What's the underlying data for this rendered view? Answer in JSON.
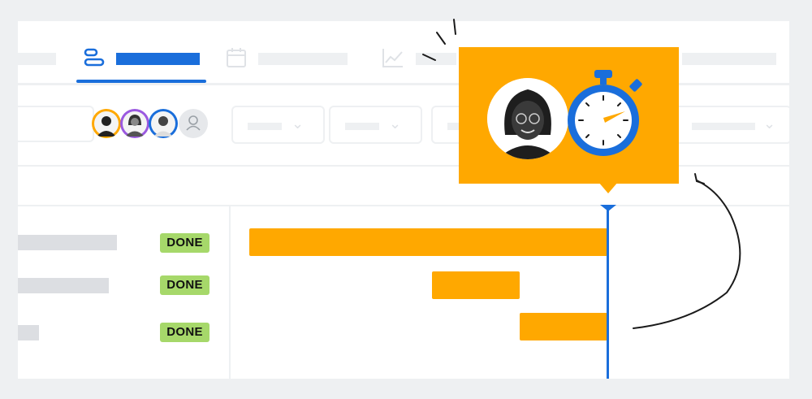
{
  "tabs": {
    "items": [
      {
        "icon": "timeline-icon",
        "active": true
      },
      {
        "icon": "calendar-icon",
        "active": false
      },
      {
        "icon": "chart-icon",
        "active": false
      }
    ]
  },
  "colors": {
    "accent": "#1a6edb",
    "bar": "#ffa800",
    "done": "#a6d86a",
    "placeholder": "#eef0f2"
  },
  "avatars": [
    {
      "icon": "avatar-photo",
      "ring": "#ffa800"
    },
    {
      "icon": "avatar-photo",
      "ring": "#9b59e0"
    },
    {
      "icon": "avatar-photo",
      "ring": "#1a6edb"
    },
    {
      "icon": "user-placeholder-icon",
      "ring": "#dcdee2"
    }
  ],
  "rows": [
    {
      "status": "DONE"
    },
    {
      "status": "DONE"
    },
    {
      "status": "DONE"
    }
  ],
  "callout": {
    "icons": [
      "person-photo",
      "stopwatch-icon"
    ]
  }
}
